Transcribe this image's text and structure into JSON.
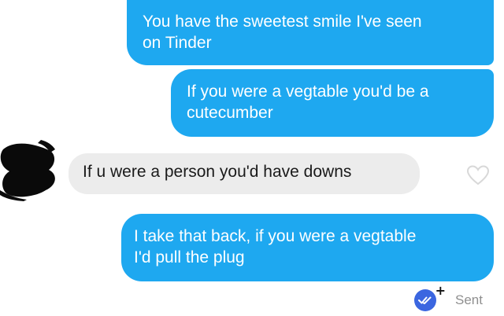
{
  "messages": [
    {
      "direction": "outgoing",
      "text": "You have the sweetest smile I've seen\non Tinder"
    },
    {
      "direction": "outgoing",
      "text": "If you were a vegtable you'd be a\ncutecumber"
    },
    {
      "direction": "incoming",
      "text": "If u were a person you'd have downs"
    },
    {
      "direction": "outgoing",
      "text": "I take that back, if you were a vegtable\nI'd pull the plug"
    }
  ],
  "avatar": {
    "description": "redacted-profile-photo"
  },
  "like_icon": "heart-outline-icon",
  "status": {
    "badge_icon": "double-check-icon",
    "plus_label": "+",
    "label": "Sent"
  },
  "colors": {
    "outgoing_bubble": "#1ea8f0",
    "incoming_bubble": "#ececec",
    "status_badge": "#3b66e0",
    "status_text": "#8f8f8f"
  }
}
